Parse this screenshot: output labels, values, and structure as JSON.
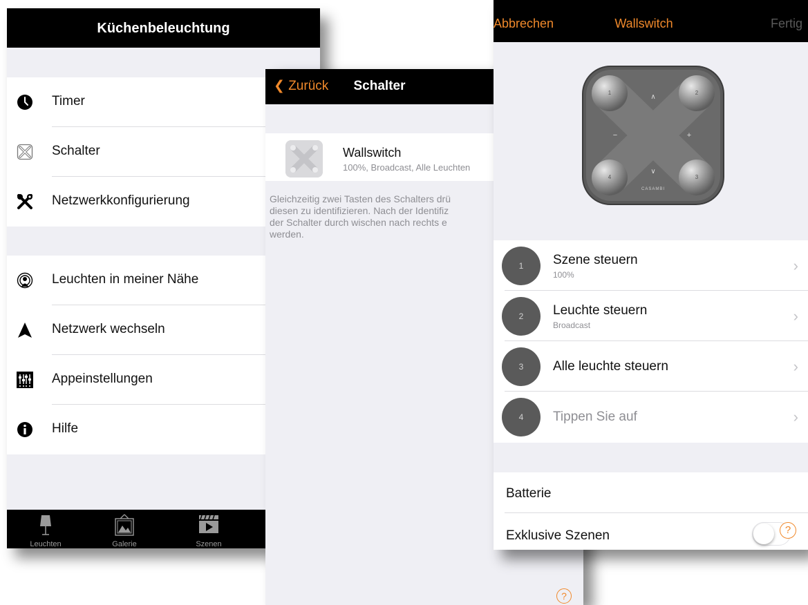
{
  "colors": {
    "accent": "#f0892b",
    "navbar": "#000000",
    "background": "#efeff4",
    "button_circle": "#5a5a5a"
  },
  "screen1": {
    "title": "Küchenbeleuchtung",
    "group1": [
      {
        "label": "Timer",
        "icon": "clock-icon"
      },
      {
        "label": "Schalter",
        "icon": "switch-icon"
      },
      {
        "label": "Netzwerkkonfigurierung",
        "icon": "tools-icon"
      }
    ],
    "group2": [
      {
        "label": "Leuchten in meiner Nähe",
        "icon": "nearby-icon"
      },
      {
        "label": "Netzwerk wechseln",
        "icon": "navigate-icon"
      },
      {
        "label": "Appeinstellungen",
        "icon": "sliders-icon"
      },
      {
        "label": "Hilfe",
        "icon": "info-icon"
      }
    ],
    "tabs": [
      {
        "label": "Leuchten",
        "icon": "lamp-icon"
      },
      {
        "label": "Galerie",
        "icon": "gallery-icon"
      },
      {
        "label": "Szenen",
        "icon": "scenes-icon"
      }
    ]
  },
  "screen2": {
    "back": "Zurück",
    "title": "Schalter",
    "switch": {
      "name": "Wallswitch",
      "details": "100%, Broadcast, Alle Leuchten"
    },
    "info_lines": [
      "Gleichzeitig zwei Tasten des Schalters drü",
      "diesen zu identifizieren. Nach der Identifiz",
      "der Schalter durch wischen nach rechts e",
      "werden."
    ],
    "help": "?"
  },
  "screen3": {
    "cancel": "Abbrechen",
    "title": "Wallswitch",
    "done": "Fertig",
    "device": {
      "brand": "CASAMBI",
      "corner_numbers": [
        "1",
        "2",
        "3",
        "4"
      ],
      "arrow_labels": {
        "up": "∧",
        "down": "∨",
        "minus": "−",
        "plus": "+"
      }
    },
    "buttons": [
      {
        "number": "1",
        "title": "Szene steuern",
        "subtitle": "100%"
      },
      {
        "number": "2",
        "title": "Leuchte steuern",
        "subtitle": "Broadcast"
      },
      {
        "number": "3",
        "title": "Alle leuchte steuern",
        "subtitle": ""
      },
      {
        "number": "4",
        "title": "Tippen Sie auf",
        "subtitle": ""
      }
    ],
    "chevron": "›",
    "battery": "Batterie",
    "exclusive_scenes": "Exklusive Szenen",
    "exclusive_scenes_on": false,
    "help": "?"
  }
}
